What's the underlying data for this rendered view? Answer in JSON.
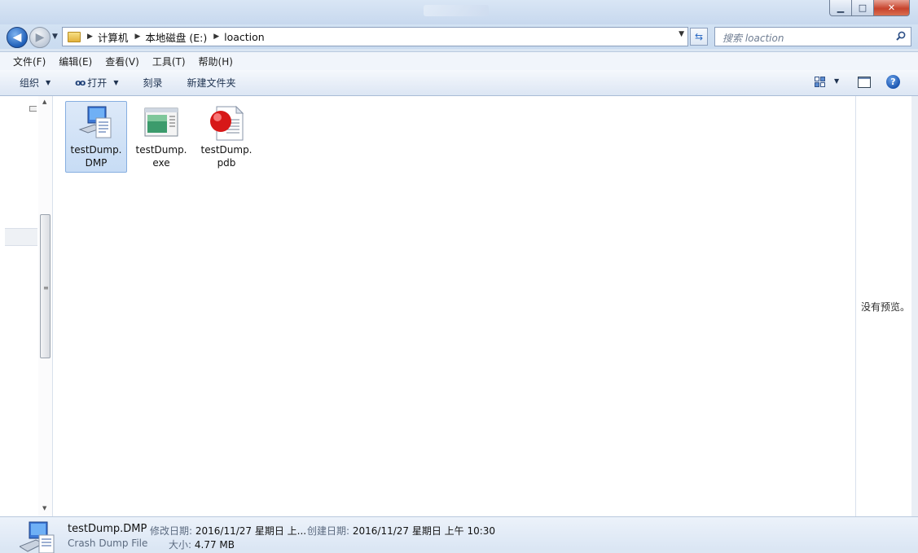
{
  "window": {
    "buttons": {
      "minimize": "▁",
      "maximize": "□",
      "close": "✕"
    }
  },
  "address": {
    "crumbs": [
      "计算机",
      "本地磁盘 (E:)",
      "loaction"
    ],
    "search_placeholder": "搜索 loaction"
  },
  "menubar": {
    "items": [
      "文件(F)",
      "编辑(E)",
      "查看(V)",
      "工具(T)",
      "帮助(H)"
    ]
  },
  "toolbar": {
    "organize": "组织",
    "open": "打开",
    "burn": "刻录",
    "new_folder": "新建文件夹"
  },
  "files": [
    {
      "name": "testDump.\nDMP",
      "icon": "dump-file-icon",
      "selected": true
    },
    {
      "name": "testDump.\nexe",
      "icon": "exe-file-icon",
      "selected": false
    },
    {
      "name": "testDump.\npdb",
      "icon": "pdb-file-icon",
      "selected": false
    }
  ],
  "preview": {
    "text": "没有预览。"
  },
  "details": {
    "name": "testDump.DMP",
    "type": "Crash Dump File",
    "modified_label": "修改日期:",
    "modified_value": "2016/11/27 星期日 上...",
    "created_label": "创建日期:",
    "created_value": "2016/11/27 星期日 上午 10:30",
    "size_label": "大小:",
    "size_value": "4.77 MB"
  },
  "colors": {
    "accent": "#1f5fb8",
    "selection": "#c7dcf5",
    "selection_border": "#86aee0"
  }
}
